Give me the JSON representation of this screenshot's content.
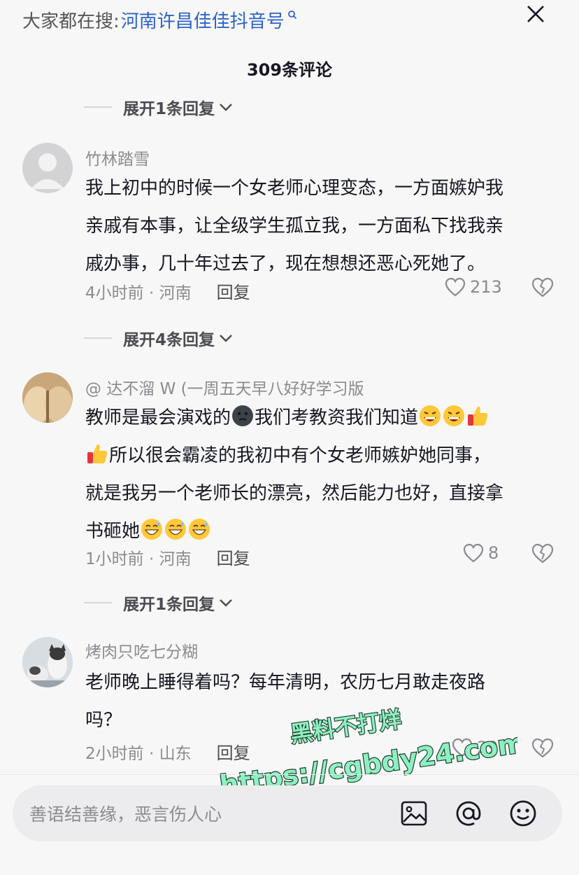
{
  "header": {
    "search_prefix": "大家都在搜:",
    "search_query": "河南许昌佳佳抖音号",
    "close_icon": "close-icon"
  },
  "comment_count": "309条评论",
  "expand_1": "展开1条回复",
  "expand_2": "展开4条回复",
  "expand_3": "展开1条回复",
  "comments": [
    {
      "username": "竹林踏雪",
      "lines": [
        "我上初中的时候一个女老师心理变态，一方面嫉妒我",
        "亲戚有本事，让全级学生孤立我，一方面私下找我亲",
        "戚办事，几十年过去了，现在想想还恶心死她了。"
      ],
      "time_location": "4小时前 · 河南",
      "reply": "回复",
      "likes": "213"
    },
    {
      "username": "@   达不溜 W (一周五天早八好好学习版",
      "line1_a": "教师是最会演戏的",
      "line1_b": "我们考教资我们知道",
      "line2": "所以很会霸凌的我初中有个女老师嫉妒她同事，",
      "line3": "就是我另一个老师长的漂亮，然后能力也好，直接拿",
      "line4": "书砸她",
      "time_location": "1小时前 · 河南",
      "reply": "回复",
      "likes": "8"
    },
    {
      "username": "烤肉只吃七分糊",
      "lines": [
        "老师晚上睡得着吗？每年清明，农历七月敢走夜路",
        "吗？"
      ],
      "time_location": "2小时前 · 山东",
      "reply": "回复",
      "likes": "29"
    }
  ],
  "input": {
    "placeholder": "善语结善缘，恶言伤人心"
  },
  "watermark": {
    "line1": "黑料不打烊",
    "line2": "https://cgbdy24.com"
  },
  "colors": {
    "accent_link": "#2c63c9",
    "watermark_fill": "#8ef0c0",
    "watermark_stroke": "#1a3a2a"
  }
}
